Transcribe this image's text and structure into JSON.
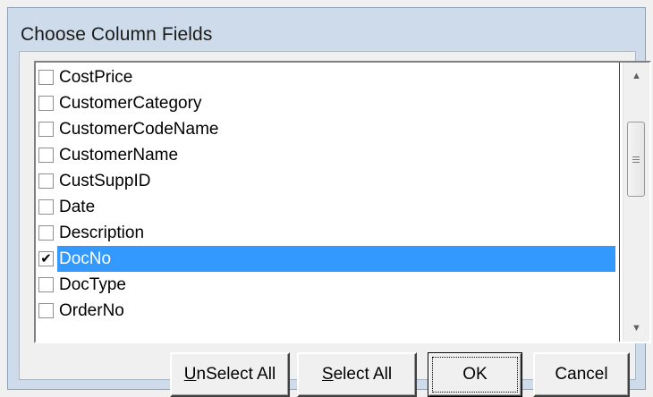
{
  "dialog": {
    "title": "Choose Column Fields"
  },
  "fields": {
    "items": [
      {
        "label": "CostPrice",
        "checked": false,
        "selected": false
      },
      {
        "label": "CustomerCategory",
        "checked": false,
        "selected": false
      },
      {
        "label": "CustomerCodeName",
        "checked": false,
        "selected": false
      },
      {
        "label": "CustomerName",
        "checked": false,
        "selected": false
      },
      {
        "label": "CustSuppID",
        "checked": false,
        "selected": false
      },
      {
        "label": "Date",
        "checked": false,
        "selected": false
      },
      {
        "label": "Description",
        "checked": false,
        "selected": false
      },
      {
        "label": "DocNo",
        "checked": true,
        "selected": true
      },
      {
        "label": "DocType",
        "checked": false,
        "selected": false
      },
      {
        "label": "OrderNo",
        "checked": false,
        "selected": false
      }
    ]
  },
  "buttons": {
    "unselect_all": {
      "mnemonic": "U",
      "rest": "nSelect All"
    },
    "select_all": {
      "mnemonic": "S",
      "rest": "elect All"
    },
    "ok": "OK",
    "cancel": "Cancel"
  },
  "icons": {
    "check": "✔",
    "scroll_up": "▲",
    "scroll_down": "▼"
  }
}
